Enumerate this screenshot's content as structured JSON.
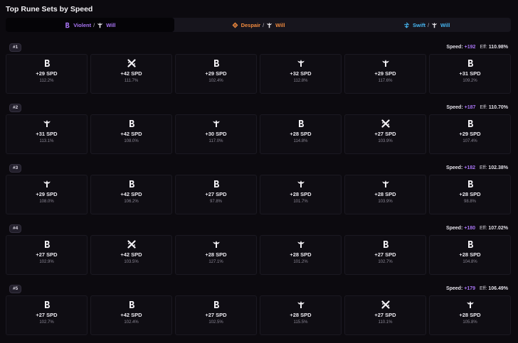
{
  "page": {
    "title": "Top Rune Sets by Speed"
  },
  "tabs": [
    {
      "primary": "Violent",
      "primary_icon": "violent",
      "primary_color": "#a874f3",
      "sep": "/",
      "secondary": "Will",
      "secondary_icon": "will",
      "secondary_color": "#a874f3",
      "active": true
    },
    {
      "primary": "Despair",
      "primary_icon": "despair",
      "primary_color": "#f08a3e",
      "sep": "/",
      "secondary": "Will",
      "secondary_icon": "will",
      "secondary_color": "#f08a3e",
      "active": false
    },
    {
      "primary": "Swift",
      "primary_icon": "swift",
      "primary_color": "#46b6f2",
      "sep": "/",
      "secondary": "Will",
      "secondary_icon": "will",
      "secondary_color": "#46b6f2",
      "active": false
    }
  ],
  "sets": [
    {
      "rank": "#1",
      "speed_label": "Speed:",
      "speed": "+192",
      "eff_label": "Eff:",
      "eff": "110.98%",
      "runes": [
        {
          "icon": "violent",
          "spd": "+29 SPD",
          "eff": "112.2%"
        },
        {
          "icon": "cross",
          "spd": "+42 SPD",
          "eff": "111.7%"
        },
        {
          "icon": "violent",
          "spd": "+29 SPD",
          "eff": "102.4%"
        },
        {
          "icon": "will",
          "spd": "+32 SPD",
          "eff": "112.8%"
        },
        {
          "icon": "will",
          "spd": "+29 SPD",
          "eff": "117.6%"
        },
        {
          "icon": "violent",
          "spd": "+31 SPD",
          "eff": "109.2%"
        }
      ]
    },
    {
      "rank": "#2",
      "speed_label": "Speed:",
      "speed": "+187",
      "eff_label": "Eff:",
      "eff": "110.70%",
      "runes": [
        {
          "icon": "will",
          "spd": "+31 SPD",
          "eff": "113.1%"
        },
        {
          "icon": "violent",
          "spd": "+42 SPD",
          "eff": "108.0%"
        },
        {
          "icon": "will",
          "spd": "+30 SPD",
          "eff": "117.0%"
        },
        {
          "icon": "violent",
          "spd": "+28 SPD",
          "eff": "114.8%"
        },
        {
          "icon": "cross",
          "spd": "+27 SPD",
          "eff": "103.9%"
        },
        {
          "icon": "violent",
          "spd": "+29 SPD",
          "eff": "107.4%"
        }
      ]
    },
    {
      "rank": "#3",
      "speed_label": "Speed:",
      "speed": "+182",
      "eff_label": "Eff:",
      "eff": "102.38%",
      "runes": [
        {
          "icon": "will",
          "spd": "+29 SPD",
          "eff": "108.0%"
        },
        {
          "icon": "violent",
          "spd": "+42 SPD",
          "eff": "106.2%"
        },
        {
          "icon": "violent",
          "spd": "+27 SPD",
          "eff": "97.8%"
        },
        {
          "icon": "will",
          "spd": "+28 SPD",
          "eff": "101.7%"
        },
        {
          "icon": "will",
          "spd": "+28 SPD",
          "eff": "103.9%"
        },
        {
          "icon": "violent",
          "spd": "+28 SPD",
          "eff": "98.8%"
        }
      ]
    },
    {
      "rank": "#4",
      "speed_label": "Speed:",
      "speed": "+180",
      "eff_label": "Eff:",
      "eff": "107.02%",
      "runes": [
        {
          "icon": "violent",
          "spd": "+27 SPD",
          "eff": "102.9%"
        },
        {
          "icon": "cross",
          "spd": "+42 SPD",
          "eff": "103.5%"
        },
        {
          "icon": "will",
          "spd": "+28 SPD",
          "eff": "127.1%"
        },
        {
          "icon": "will",
          "spd": "+28 SPD",
          "eff": "101.2%"
        },
        {
          "icon": "violent",
          "spd": "+27 SPD",
          "eff": "102.7%"
        },
        {
          "icon": "violent",
          "spd": "+28 SPD",
          "eff": "104.8%"
        }
      ]
    },
    {
      "rank": "#5",
      "speed_label": "Speed:",
      "speed": "+179",
      "eff_label": "Eff:",
      "eff": "106.49%",
      "runes": [
        {
          "icon": "violent",
          "spd": "+27 SPD",
          "eff": "102.7%"
        },
        {
          "icon": "violent",
          "spd": "+42 SPD",
          "eff": "102.4%"
        },
        {
          "icon": "violent",
          "spd": "+27 SPD",
          "eff": "102.5%"
        },
        {
          "icon": "will",
          "spd": "+28 SPD",
          "eff": "115.5%"
        },
        {
          "icon": "cross",
          "spd": "+27 SPD",
          "eff": "110.1%"
        },
        {
          "icon": "will",
          "spd": "+28 SPD",
          "eff": "105.8%"
        }
      ]
    }
  ]
}
